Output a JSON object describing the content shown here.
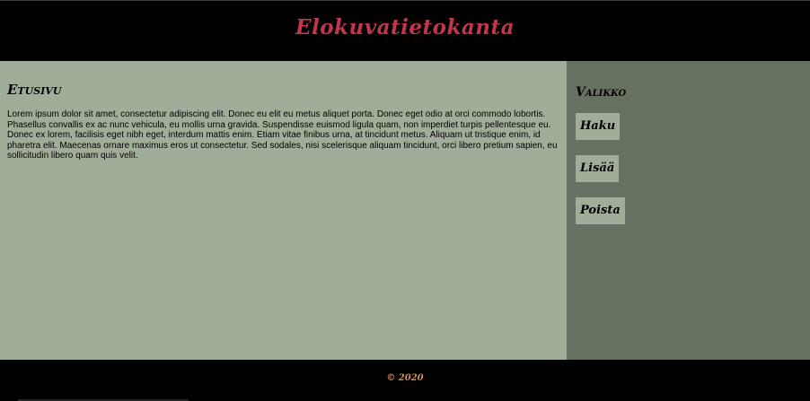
{
  "header": {
    "title": "Elokuvatietokanta"
  },
  "main": {
    "heading": "Etusivu",
    "text": "Lorem ipsum dolor sit amet, consectetur adipiscing elit. Donec eu elit eu metus aliquet porta. Donec eget odio at orci commodo lobortis. Phasellus convallis ex ac nunc vehicula, eu mollis urna gravida. Suspendisse euismod ligula quam, non imperdiet turpis pellentesque eu. Donec ex lorem, facilisis eget nibh eget, interdum mattis enim. Etiam vitae finibus urna, at tincidunt metus. Aliquam ut tristique enim, id pharetra elit. Maecenas ornare maximus eros ut consectetur. Sed sodales, nisi scelerisque aliquam tincidunt, orci libero pretium sapien, eu sollicitudin libero quam quis velit."
  },
  "sidebar": {
    "heading": "Valikko",
    "items": [
      {
        "label": "Haku"
      },
      {
        "label": "Lisää"
      },
      {
        "label": "Poista"
      }
    ]
  },
  "footer": {
    "copyright": "© 2020"
  },
  "colors": {
    "title": "#c0374c",
    "main_bg": "#a0ad98",
    "sidebar_bg": "#677161",
    "footer_text": "#d38a54",
    "header_bg": "#000000"
  }
}
